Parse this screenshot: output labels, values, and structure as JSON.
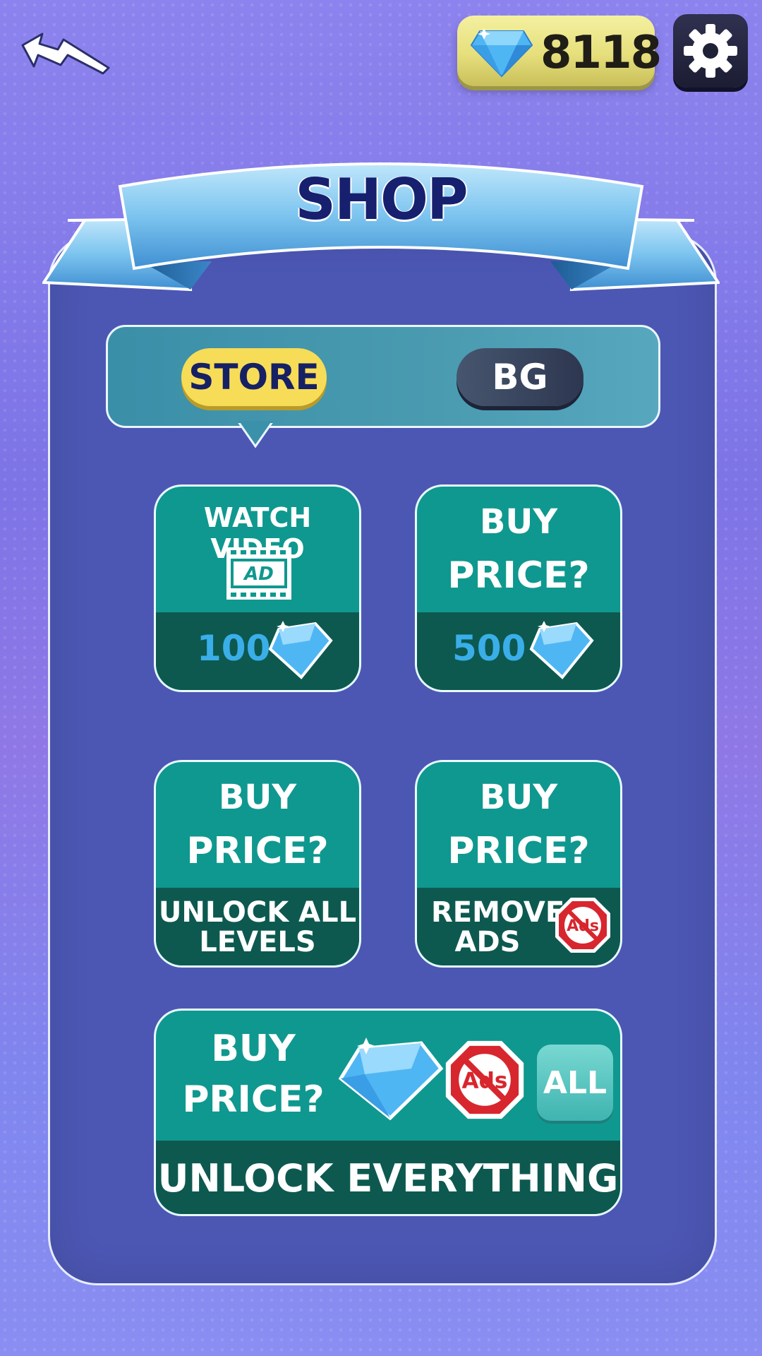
{
  "topbar": {
    "gem_count": "8118"
  },
  "shop": {
    "title": "SHOP",
    "tabs": [
      {
        "label": "STORE",
        "active": true
      },
      {
        "label": "BG",
        "active": false
      }
    ]
  },
  "cards": {
    "watch_video": {
      "title": "WATCH VIDEO",
      "ad_label": "AD",
      "reward": "100"
    },
    "buy_500": {
      "line1": "BUY",
      "line2": "PRICE?",
      "reward": "500"
    },
    "unlock_levels": {
      "line1": "BUY",
      "line2": "PRICE?",
      "label_1": "UNLOCK ALL",
      "label_2": "LEVELS"
    },
    "remove_ads": {
      "line1": "BUY",
      "line2": "PRICE?",
      "label_1": "REMOVE",
      "label_2": "ADS",
      "icon_text": "Ads"
    },
    "everything": {
      "line1": "BUY",
      "line2": "PRICE?",
      "icon_text": "Ads",
      "all_label": "ALL",
      "label": "UNLOCK EVERYTHING"
    }
  },
  "colors": {
    "gem": "#4fb6f4",
    "card": "#0f988f",
    "card_dark": "#0d5950",
    "accent_yellow": "#f7dc57"
  }
}
